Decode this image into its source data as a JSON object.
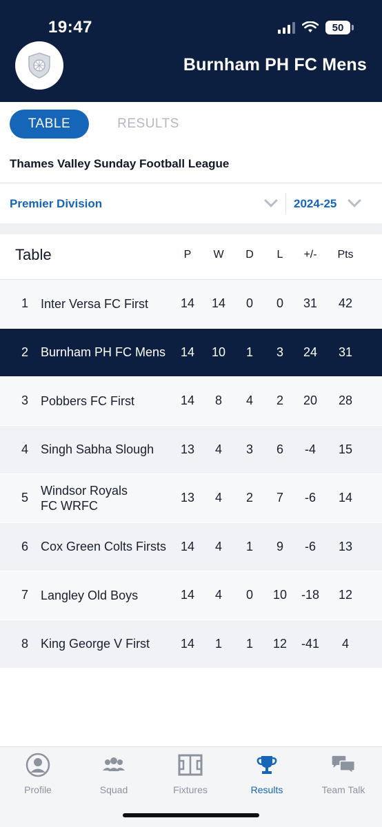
{
  "status_bar": {
    "time": "19:47",
    "battery": "50"
  },
  "header": {
    "club_name": "Burnham PH FC Mens",
    "logo_icon": "shield-football-icon"
  },
  "tabs": [
    {
      "label": "TABLE",
      "active": true
    },
    {
      "label": "RESULTS",
      "active": false
    }
  ],
  "league": {
    "name": "Thames Valley Sunday Football League"
  },
  "filters": {
    "division": "Premier Division",
    "season": "2024-25"
  },
  "table": {
    "title": "Table",
    "columns": [
      "P",
      "W",
      "D",
      "L",
      "+/-",
      "Pts"
    ],
    "rows": [
      {
        "pos": "1",
        "team": "Inter Versa FC First",
        "p": "14",
        "w": "14",
        "d": "0",
        "l": "0",
        "gd": "31",
        "pts": "42"
      },
      {
        "pos": "2",
        "team": "Burnham PH FC Mens",
        "p": "14",
        "w": "10",
        "d": "1",
        "l": "3",
        "gd": "24",
        "pts": "31"
      },
      {
        "pos": "3",
        "team": "Pobbers FC First",
        "p": "14",
        "w": "8",
        "d": "4",
        "l": "2",
        "gd": "20",
        "pts": "28"
      },
      {
        "pos": "4",
        "team": "Singh Sabha Slough",
        "p": "13",
        "w": "4",
        "d": "3",
        "l": "6",
        "gd": "-4",
        "pts": "15"
      },
      {
        "pos": "5",
        "team": "Windsor Royals FC WRFC",
        "p": "13",
        "w": "4",
        "d": "2",
        "l": "7",
        "gd": "-6",
        "pts": "14"
      },
      {
        "pos": "6",
        "team": "Cox Green Colts Firsts",
        "p": "14",
        "w": "4",
        "d": "1",
        "l": "9",
        "gd": "-6",
        "pts": "13"
      },
      {
        "pos": "7",
        "team": "Langley Old Boys",
        "p": "14",
        "w": "4",
        "d": "0",
        "l": "10",
        "gd": "-18",
        "pts": "12"
      },
      {
        "pos": "8",
        "team": "King George V First",
        "p": "14",
        "w": "1",
        "d": "1",
        "l": "12",
        "gd": "-41",
        "pts": "4"
      }
    ]
  },
  "bottom_nav": [
    {
      "label": "Profile",
      "icon": "profile-icon",
      "active": false
    },
    {
      "label": "Squad",
      "icon": "squad-icon",
      "active": false
    },
    {
      "label": "Fixtures",
      "icon": "pitch-icon",
      "active": false
    },
    {
      "label": "Results",
      "icon": "trophy-icon",
      "active": true
    },
    {
      "label": "Team Talk",
      "icon": "chat-bubbles-icon",
      "active": false
    }
  ],
  "colors": {
    "header_bg": "#0d1f40",
    "accent": "#1565b8",
    "highlight_row": "#0d1f40",
    "inactive": "#8d939e"
  }
}
